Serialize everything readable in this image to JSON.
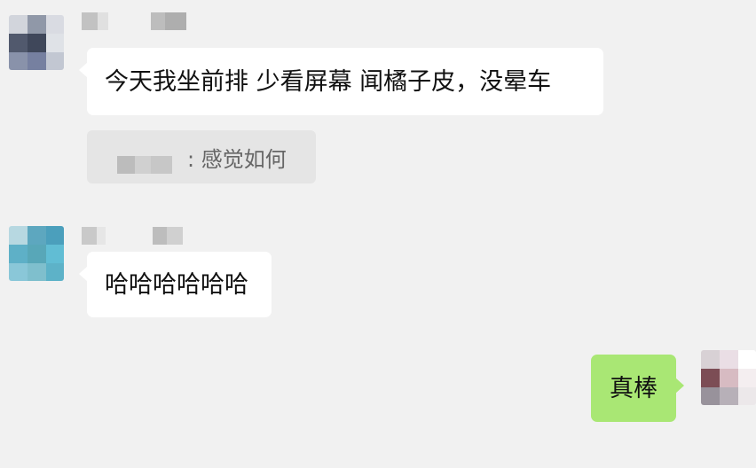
{
  "conversation": {
    "messages": [
      {
        "side": "incoming",
        "text": "今天我坐前排  少看屏幕  闻橘子皮，没晕车"
      },
      {
        "side": "incoming",
        "kind": "quote",
        "quoted_text": ": 感觉如何"
      },
      {
        "side": "incoming",
        "text": "哈哈哈哈哈哈"
      },
      {
        "side": "outgoing",
        "text": "真棒"
      }
    ]
  },
  "colors": {
    "chat_background": "#f1f1f1",
    "incoming_bubble": "#ffffff",
    "outgoing_bubble": "#a9e774",
    "quote_background": "#e5e5e5",
    "quote_text": "#666666",
    "message_text": "#111111"
  },
  "icons": {
    "avatar_1": "blurred-avatar-icon",
    "avatar_2": "blurred-avatar-icon",
    "avatar_3": "blurred-avatar-icon"
  }
}
